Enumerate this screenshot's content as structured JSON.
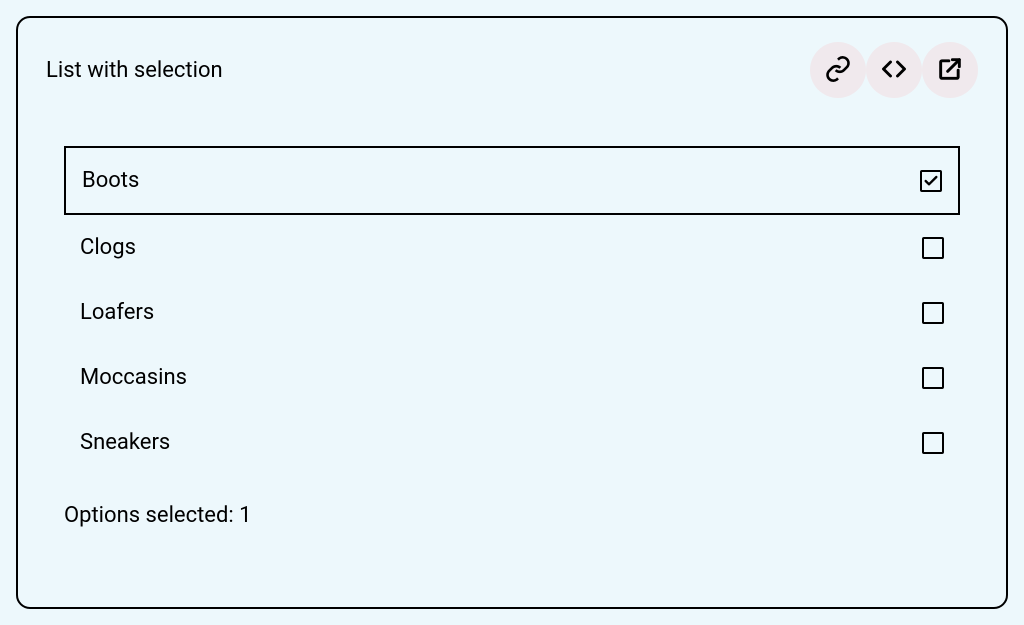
{
  "card": {
    "title": "List with selection"
  },
  "list": {
    "items": [
      {
        "label": "Boots",
        "checked": true
      },
      {
        "label": "Clogs",
        "checked": false
      },
      {
        "label": "Loafers",
        "checked": false
      },
      {
        "label": "Moccasins",
        "checked": false
      },
      {
        "label": "Sneakers",
        "checked": false
      }
    ]
  },
  "summary": {
    "label": "Options selected: 1"
  }
}
